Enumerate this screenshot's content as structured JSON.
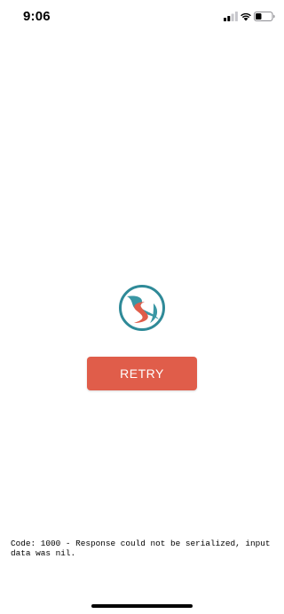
{
  "status_bar": {
    "time": "9:06",
    "signal_icon": "cellular-signal-icon",
    "wifi_icon": "wifi-icon",
    "battery_icon": "battery-icon"
  },
  "logo": {
    "icon": "road-logo-icon",
    "colors": {
      "ring": "#2f8a98",
      "road_teal": "#3a97a4",
      "road_red": "#e05d4a"
    }
  },
  "retry_button": {
    "label": "RETRY",
    "color": "#e05d4a"
  },
  "error": {
    "message": "Code: 1000 - Response could not be serialized, input data was nil."
  }
}
